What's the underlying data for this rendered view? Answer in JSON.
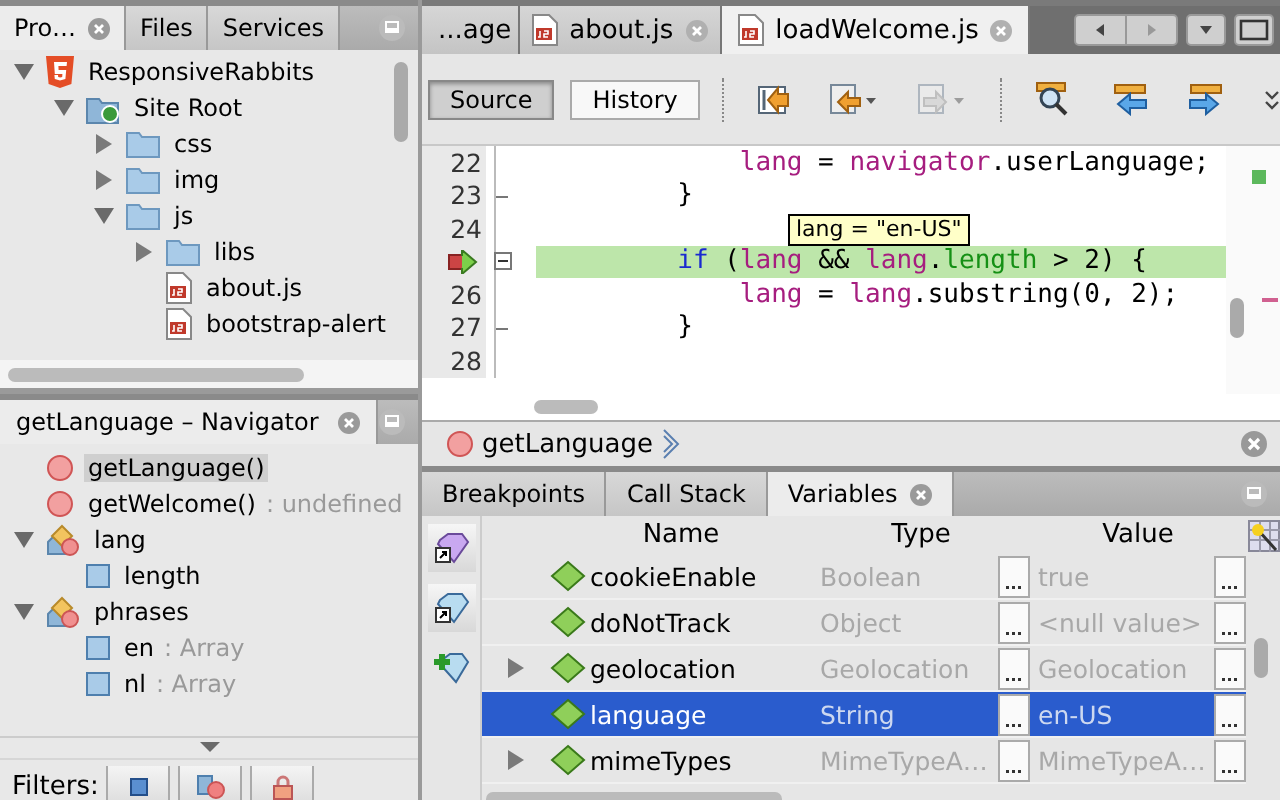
{
  "project_panel": {
    "tabs": [
      {
        "label": "Pro…",
        "selected": true,
        "closable": true
      },
      {
        "label": "Files",
        "selected": false,
        "closable": false
      },
      {
        "label": "Services",
        "selected": false,
        "closable": false
      }
    ],
    "tree": [
      {
        "label": "ResponsiveRabbits",
        "kind": "project",
        "expanded": true,
        "children": [
          {
            "label": "Site Root",
            "kind": "site-root",
            "expanded": true,
            "children": [
              {
                "label": "css",
                "kind": "folder",
                "expanded": false
              },
              {
                "label": "img",
                "kind": "folder",
                "expanded": false
              },
              {
                "label": "js",
                "kind": "folder",
                "expanded": true,
                "children": [
                  {
                    "label": "libs",
                    "kind": "folder",
                    "expanded": false
                  },
                  {
                    "label": "about.js",
                    "kind": "file"
                  },
                  {
                    "label": "bootstrap-alert",
                    "kind": "file"
                  }
                ]
              }
            ]
          }
        ]
      }
    ]
  },
  "navigator": {
    "title": "getLanguage – Navigator",
    "items": [
      {
        "label": "getLanguage()",
        "kind": "method",
        "selected": true
      },
      {
        "label": "getWelcome()",
        "detail": ": undefined",
        "kind": "method",
        "selected": false
      },
      {
        "label": "lang",
        "kind": "object",
        "selected": false,
        "expanded": true,
        "children": [
          {
            "label": "length",
            "kind": "property",
            "selected": false
          }
        ]
      },
      {
        "label": "phrases",
        "kind": "object",
        "selected": false,
        "expanded": true,
        "children": [
          {
            "label": "en",
            "detail": ": Array",
            "kind": "property",
            "selected": false
          },
          {
            "label": "nl",
            "detail": ": Array",
            "kind": "property",
            "selected": false
          }
        ]
      }
    ],
    "filters_label": "Filters:",
    "filters": [
      {
        "kind": "fields"
      },
      {
        "kind": "static"
      },
      {
        "kind": "private"
      }
    ]
  },
  "editor": {
    "tabs": [
      {
        "label": "...age",
        "kind": "clipped",
        "selected": false
      },
      {
        "label": "about.js",
        "kind": "js",
        "selected": false
      },
      {
        "label": "loadWelcome.js",
        "kind": "js",
        "selected": true
      }
    ],
    "views": [
      {
        "label": "Source",
        "selected": true
      },
      {
        "label": "History",
        "selected": false
      }
    ],
    "tools": [
      {
        "kind": "jump",
        "disabled": false
      },
      {
        "kind": "back",
        "disabled": false
      },
      {
        "kind": "forward",
        "disabled": true
      },
      {
        "kind": "find",
        "disabled": false
      },
      {
        "kind": "previous",
        "disabled": false
      },
      {
        "kind": "next",
        "disabled": false
      },
      {
        "kind": "more",
        "disabled": false
      }
    ],
    "lines": [
      {
        "number": "22",
        "current": false,
        "fold_start": false,
        "fold_end": false,
        "tokens": [
          {
            "kind": "variable",
            "text": "            lang"
          },
          {
            "kind": "plain",
            "text": " = "
          },
          {
            "kind": "variable",
            "text": "navigator"
          },
          {
            "kind": "plain",
            "text": ".userLanguage;"
          }
        ]
      },
      {
        "number": "23",
        "current": false,
        "fold_start": false,
        "fold_end": true,
        "tokens": [
          {
            "kind": "plain",
            "text": "        }"
          }
        ]
      },
      {
        "number": "24",
        "current": false,
        "fold_start": false,
        "fold_end": false
      },
      {
        "current": true,
        "fold_start": true,
        "fold_end": false,
        "tokens": [
          {
            "kind": "keyword",
            "text": "        if"
          },
          {
            "kind": "plain",
            "text": " ("
          },
          {
            "kind": "variable",
            "text": "lang"
          },
          {
            "kind": "plain",
            "text": " && "
          },
          {
            "kind": "variable",
            "text": "lang"
          },
          {
            "kind": "plain",
            "text": "."
          },
          {
            "kind": "property",
            "text": "length"
          },
          {
            "kind": "plain",
            "text": " > 2) {"
          }
        ]
      },
      {
        "number": "26",
        "current": false,
        "fold_start": false,
        "fold_end": false,
        "tokens": [
          {
            "kind": "variable",
            "text": "            lang"
          },
          {
            "kind": "plain",
            "text": " = "
          },
          {
            "kind": "variable",
            "text": "lang"
          },
          {
            "kind": "plain",
            "text": ".substring(0, 2);"
          }
        ]
      },
      {
        "number": "27",
        "current": false,
        "fold_start": false,
        "fold_end": true,
        "tokens": [
          {
            "kind": "plain",
            "text": "        }"
          }
        ]
      },
      {
        "number": "28",
        "current": false,
        "fold_start": false,
        "fold_end": false
      }
    ],
    "tooltip": "lang = \"en-US\"",
    "breadcrumb": "getLanguage"
  },
  "debugger": {
    "tabs": [
      {
        "label": "Breakpoints",
        "selected": false
      },
      {
        "label": "Call Stack",
        "selected": false
      },
      {
        "label": "Variables",
        "selected": true
      }
    ],
    "columns": [
      "Name",
      "Type",
      "Value"
    ],
    "rows": [
      {
        "name": "cookieEnable",
        "type": "Boolean",
        "value": "true",
        "kind": "leaf",
        "selected": false
      },
      {
        "name": "doNotTrack",
        "type": "Object",
        "value": "<null value>",
        "kind": "leaf",
        "selected": false
      },
      {
        "name": "geolocation",
        "type": "Geolocation",
        "value": "Geolocation",
        "kind": "branch",
        "selected": false
      },
      {
        "name": "language",
        "type": "String",
        "value": "en-US",
        "kind": "leaf",
        "selected": true
      },
      {
        "name": "mimeTypes",
        "type": "MimeTypeA…",
        "value": "MimeTypeA…",
        "kind": "branch",
        "selected": false
      }
    ]
  }
}
